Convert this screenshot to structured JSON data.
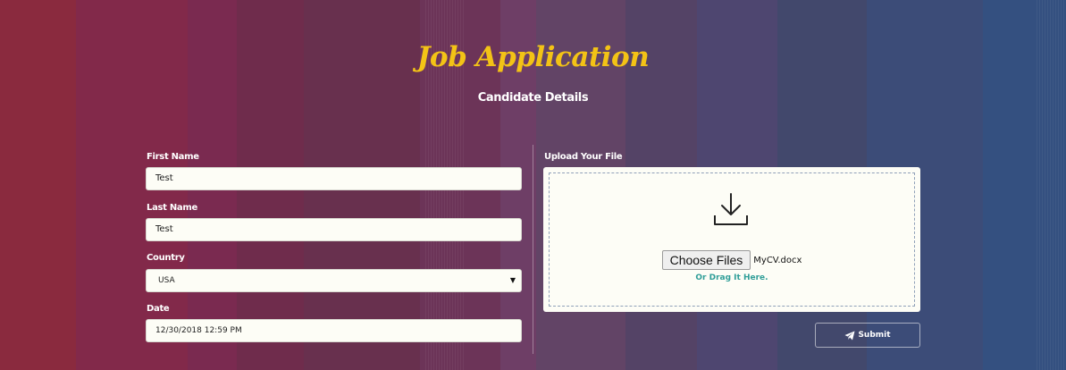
{
  "header": {
    "title": "Job Application",
    "subtitle": "Candidate Details"
  },
  "form": {
    "first_name": {
      "label": "First Name",
      "value": "Test"
    },
    "last_name": {
      "label": "Last Name",
      "value": "Test"
    },
    "country": {
      "label": "Country",
      "value": "USA",
      "icon": "caret-down-icon"
    },
    "date": {
      "label": "Date",
      "value": "12/30/2018 12:59 PM"
    }
  },
  "upload": {
    "label": "Upload Your File",
    "icon": "download-icon",
    "choose_button": "Choose Files",
    "file_name": "MyCV.docx",
    "drag_text": "Or Drag It Here."
  },
  "submit": {
    "label": "Submit",
    "icon": "paper-plane-icon"
  },
  "colors": {
    "title": "#f3c316",
    "accent": "#2f9e98",
    "field_background": "#fdfdf6"
  }
}
